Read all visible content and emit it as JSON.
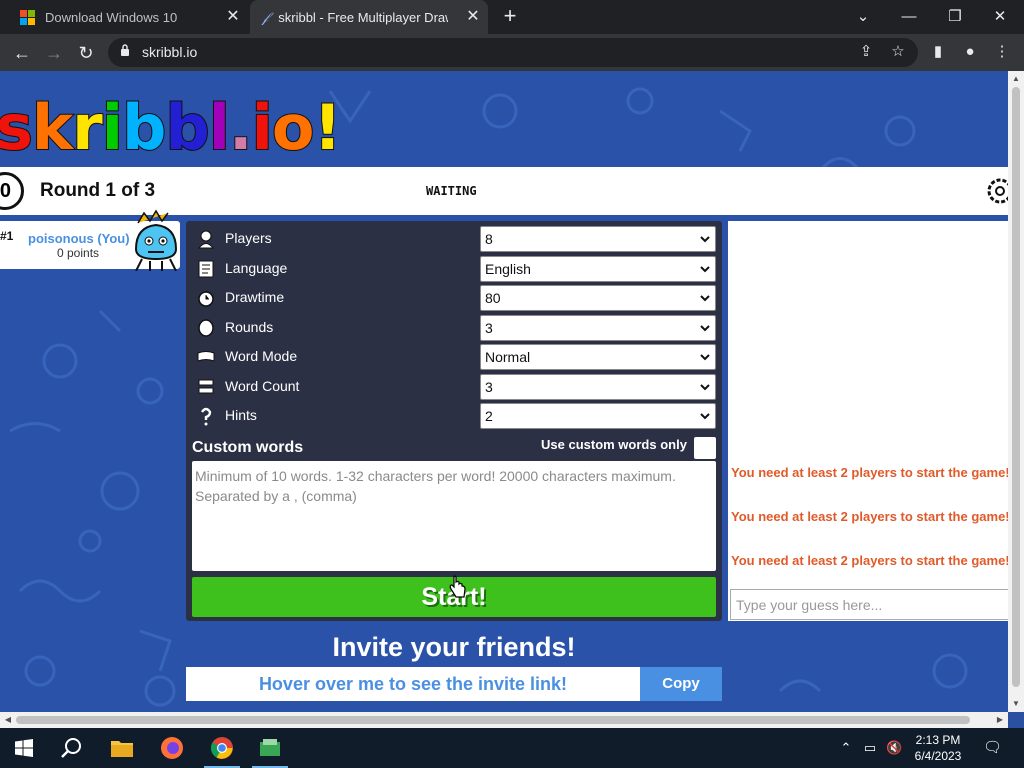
{
  "browser": {
    "tabs": [
      {
        "title": "Download Windows 10",
        "active": false
      },
      {
        "title": "skribbl - Free Multiplayer Drawin",
        "active": true
      }
    ],
    "url": "skribbl.io"
  },
  "game": {
    "logo": [
      "s",
      "k",
      "r",
      "i",
      "b",
      "b",
      "l",
      ".",
      "i",
      "o",
      "!"
    ],
    "logo_colors": [
      "#ef130b",
      "#ff7100",
      "#ffe400",
      "#00cc00",
      "#00b2ff",
      "#231fd3",
      "#a300ba",
      "#d37caa",
      "#ef130b",
      "#ff7100",
      "#ffe400"
    ],
    "timer": "0",
    "round_label": "Round 1 of 3",
    "status": "WAITING",
    "player": {
      "rank": "#1",
      "name": "poisonous (You)",
      "points": "0 points"
    },
    "settings": [
      {
        "label": "Players",
        "value": "8",
        "icon": "player-icon"
      },
      {
        "label": "Language",
        "value": "English",
        "icon": "book-icon"
      },
      {
        "label": "Drawtime",
        "value": "80",
        "icon": "alarm-clock-icon"
      },
      {
        "label": "Rounds",
        "value": "3",
        "icon": "round-icon"
      },
      {
        "label": "Word Mode",
        "value": "Normal",
        "icon": "word-mode-icon"
      },
      {
        "label": "Word Count",
        "value": "3",
        "icon": "word-count-icon"
      },
      {
        "label": "Hints",
        "value": "2",
        "icon": "question-icon"
      }
    ],
    "custom_words": {
      "title": "Custom words",
      "only_label": "Use custom words only",
      "placeholder": "Minimum of 10 words. 1-32 characters per word! 20000 characters maximum. Separated by a , (comma)"
    },
    "start_label": "Start!",
    "invite": {
      "title": "Invite your friends!",
      "link_text": "Hover over me to see the invite link!",
      "copy_label": "Copy"
    },
    "chat": {
      "messages": [
        "You need at least 2 players to start the game!",
        "You need at least 2 players to start the game!",
        "You need at least 2 players to start the game!"
      ],
      "input_placeholder": "Type your guess here..."
    }
  },
  "taskbar": {
    "time": "2:13 PM",
    "date": "6/4/2023"
  },
  "colors": {
    "page_bg": "#2a52a8",
    "start_green": "#3ec11d",
    "invite_blue": "#4a90e2",
    "chat_msg": "#e05a2a",
    "panel": "#2b3044"
  }
}
